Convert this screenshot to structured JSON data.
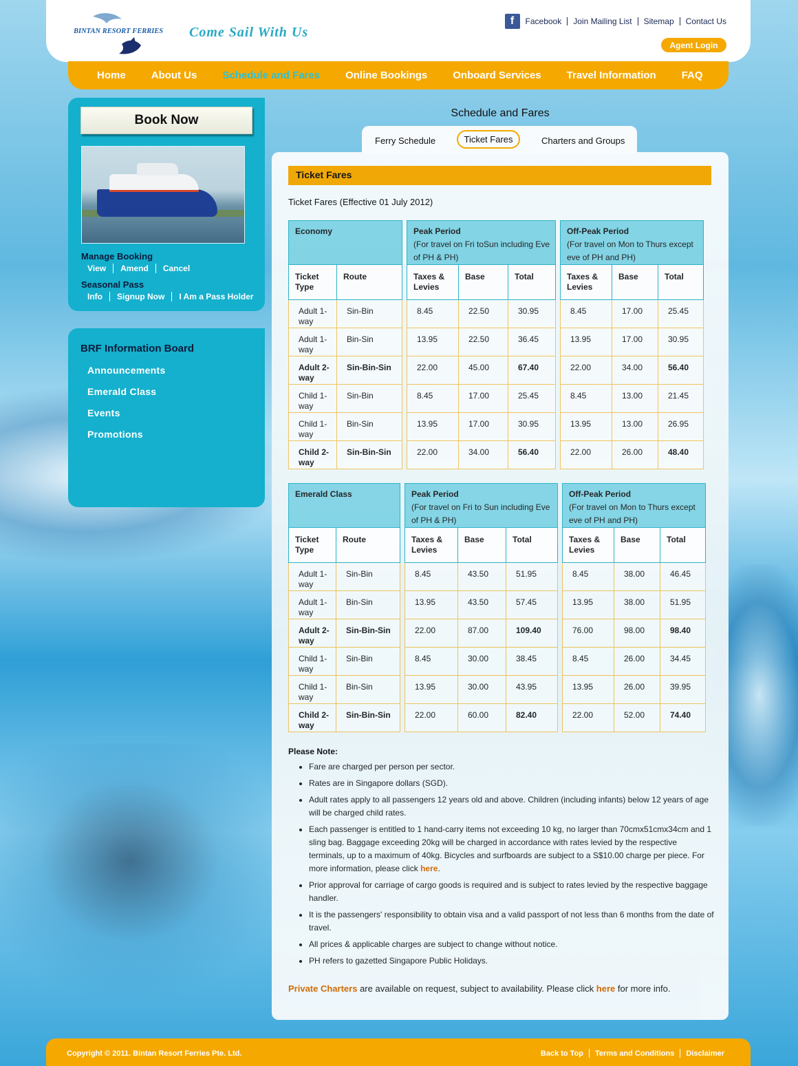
{
  "brand": {
    "logo_text": "BINTAN RESORT FERRIES",
    "tagline": "Come Sail With Us"
  },
  "toplinks": {
    "facebook": "Facebook",
    "mailing": "Join Mailing List",
    "sitemap": "Sitemap",
    "contact": "Contact Us",
    "agent_login": "Agent Login"
  },
  "nav": [
    "Home",
    "About Us",
    "Schedule and Fares",
    "Online Bookings",
    "Onboard Services",
    "Travel Information",
    "FAQ"
  ],
  "nav_active": "Schedule and Fares",
  "sidebar": {
    "book_now": "Book Now",
    "manage_booking": {
      "title": "Manage Booking",
      "links": [
        "View",
        "Amend",
        "Cancel"
      ]
    },
    "seasonal_pass": {
      "title": "Seasonal Pass",
      "links": [
        "Info",
        "Signup Now",
        "I Am a Pass Holder"
      ]
    },
    "board": {
      "title": "BRF Information Board",
      "items": [
        "Announcements",
        "Emerald Class",
        "Events",
        "Promotions"
      ]
    }
  },
  "main": {
    "title": "Schedule and Fares",
    "tabs": [
      "Ferry Schedule",
      "Ticket Fares",
      "Charters and Groups"
    ],
    "active_tab": "Ticket Fares",
    "section": "Ticket Fares",
    "subtitle": "Ticket Fares (Effective 01 July 2012)"
  },
  "tables": [
    {
      "class_label": "Economy",
      "peak_title": "Peak Period",
      "peak_note": "(For travel on Fri toSun including Eve of PH & PH)",
      "offpeak_title": "Off-Peak Period",
      "offpeak_note": "(For travel on Mon to Thurs except eve of PH and PH)",
      "cols": [
        "Ticket Type",
        "Route",
        "Taxes & Levies",
        "Base",
        "Total",
        "Taxes & Levies",
        "Base",
        "Total"
      ],
      "rows": [
        {
          "type": "Adult 1-way",
          "route": "Sin-Bin",
          "p_tax": "8.45",
          "p_base": "22.50",
          "p_total": "30.95",
          "o_tax": "8.45",
          "o_base": "17.00",
          "o_total": "25.45",
          "bold": false
        },
        {
          "type": "Adult 1-way",
          "route": "Bin-Sin",
          "p_tax": "13.95",
          "p_base": "22.50",
          "p_total": "36.45",
          "o_tax": "13.95",
          "o_base": "17.00",
          "o_total": "30.95",
          "bold": false
        },
        {
          "type": "Adult 2-way",
          "route": "Sin-Bin-Sin",
          "p_tax": "22.00",
          "p_base": "45.00",
          "p_total": "67.40",
          "o_tax": "22.00",
          "o_base": "34.00",
          "o_total": "56.40",
          "bold": true
        },
        {
          "type": "Child 1-way",
          "route": "Sin-Bin",
          "p_tax": "8.45",
          "p_base": "17.00",
          "p_total": "25.45",
          "o_tax": "8.45",
          "o_base": "13.00",
          "o_total": "21.45",
          "bold": false
        },
        {
          "type": "Child 1-way",
          "route": "Bin-Sin",
          "p_tax": "13.95",
          "p_base": "17.00",
          "p_total": "30.95",
          "o_tax": "13.95",
          "o_base": "13.00",
          "o_total": "26.95",
          "bold": false
        },
        {
          "type": "Child 2-way",
          "route": "Sin-Bin-Sin",
          "p_tax": "22.00",
          "p_base": "34.00",
          "p_total": "56.40",
          "o_tax": "22.00",
          "o_base": "26.00",
          "o_total": "48.40",
          "bold": true
        }
      ]
    },
    {
      "class_label": "Emerald Class",
      "peak_title": "Peak Period",
      "peak_note": "(For travel on Fri to Sun including Eve of PH & PH)",
      "offpeak_title": "Off-Peak Period",
      "offpeak_note": "(For travel on Mon to Thurs except eve of PH and PH)",
      "cols": [
        "Ticket Type",
        "Route",
        "Taxes & Levies",
        "Base",
        "Total",
        "Taxes & Levies",
        "Base",
        "Total"
      ],
      "rows": [
        {
          "type": "Adult 1-way",
          "route": "Sin-Bin",
          "p_tax": "8.45",
          "p_base": "43.50",
          "p_total": "51.95",
          "o_tax": "8.45",
          "o_base": "38.00",
          "o_total": "46.45",
          "bold": false
        },
        {
          "type": "Adult 1-way",
          "route": "Bin-Sin",
          "p_tax": "13.95",
          "p_base": "43.50",
          "p_total": "57.45",
          "o_tax": "13.95",
          "o_base": "38.00",
          "o_total": "51.95",
          "bold": false
        },
        {
          "type": "Adult 2-way",
          "route": "Sin-Bin-Sin",
          "p_tax": "22.00",
          "p_base": "87.00",
          "p_total": "109.40",
          "o_tax": "76.00",
          "o_base": "98.00",
          "o_total": "98.40",
          "bold": true
        },
        {
          "type": "Child 1-way",
          "route": "Sin-Bin",
          "p_tax": "8.45",
          "p_base": "30.00",
          "p_total": "38.45",
          "o_tax": "8.45",
          "o_base": "26.00",
          "o_total": "34.45",
          "bold": false
        },
        {
          "type": "Child 1-way",
          "route": "Bin-Sin",
          "p_tax": "13.95",
          "p_base": "30.00",
          "p_total": "43.95",
          "o_tax": "13.95",
          "o_base": "26.00",
          "o_total": "39.95",
          "bold": false
        },
        {
          "type": "Child 2-way",
          "route": "Sin-Bin-Sin",
          "p_tax": "22.00",
          "p_base": "60.00",
          "p_total": "82.40",
          "o_tax": "22.00",
          "o_base": "52.00",
          "o_total": "74.40",
          "bold": true
        }
      ]
    }
  ],
  "notes": {
    "title": "Please Note:",
    "items": [
      "Fare are charged per person per sector.",
      "Rates are in Singapore dollars (SGD).",
      "Adult rates apply to all passengers 12 years old and above. Children (including infants) below 12 years of age will be charged child rates.",
      "Each passenger is entitled to 1 hand-carry items not exceeding 10 kg, no larger than 70cmx51cmx34cm and 1 sling bag. Baggage exceeding 20kg will be charged in accordance with rates levied by the respective terminals, up to a maximum of 40kg. Bicycles and surfboards are subject to a S$10.00 charge per piece. For more information, please click",
      "Prior approval for carriage of cargo goods is required and is subject to rates levied by the respective baggage handler.",
      "It is the passengers' responsibility to obtain visa and a valid passport of not less than 6 months from the date of travel.",
      "All prices & applicable charges are subject to change without notice.",
      "PH refers to gazetted Singapore Public Holidays."
    ],
    "here_link": "here"
  },
  "charter": {
    "link": "Private Charters",
    "text": " are available on request, subject to availability. Please click ",
    "here": "here",
    "tail": " for more info."
  },
  "footer": {
    "copyright": "Copyright © 2011. Bintan Resort Ferries Pte. Ltd.",
    "links": [
      "Back to Top",
      "Terms and Conditions",
      "Disclaimer"
    ]
  },
  "colors": {
    "accent": "#f5a800",
    "sidebar": "#14b0cd",
    "table_header": "#84d5e6",
    "nav_active": "#2fc0d2"
  }
}
